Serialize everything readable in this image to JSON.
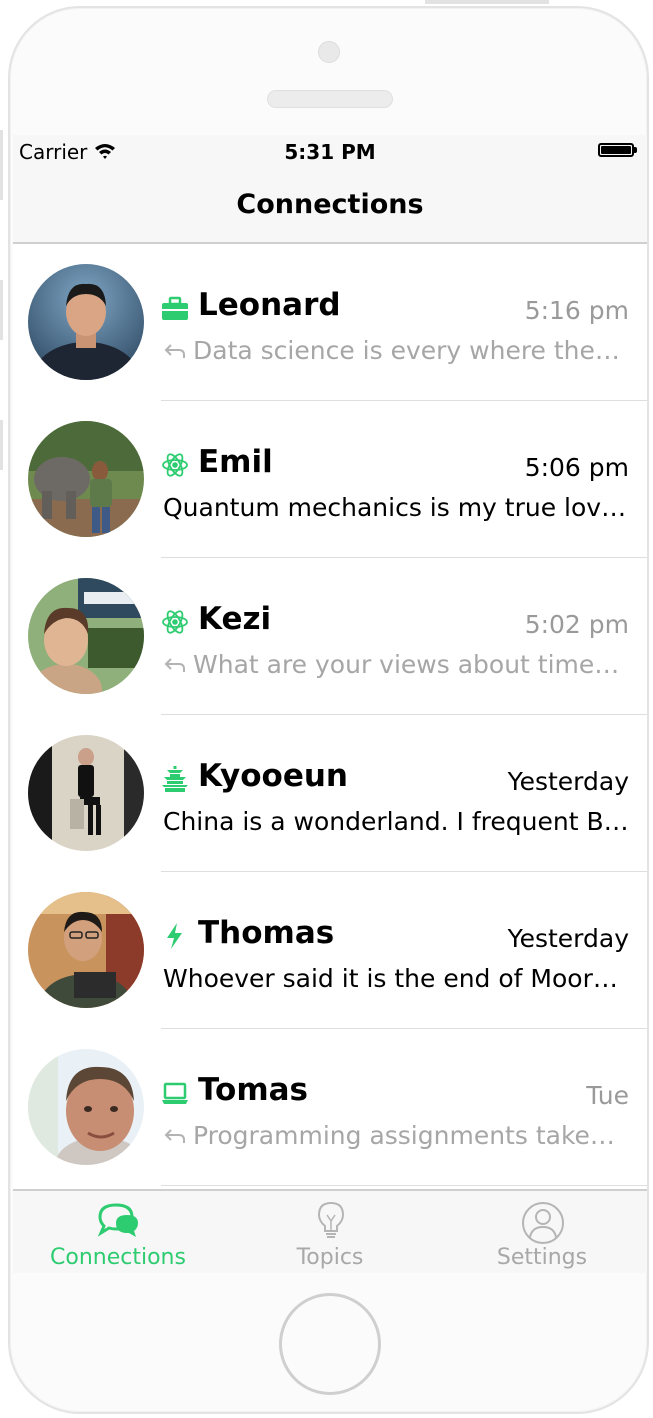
{
  "status_bar": {
    "carrier": "Carrier",
    "time": "5:31 PM"
  },
  "nav": {
    "title": "Connections"
  },
  "colors": {
    "accent": "#2ecc71",
    "muted_text": "#a6a6a6"
  },
  "conversations": [
    {
      "name": "Leonard",
      "topic_icon": "briefcase-icon",
      "time": "5:16 pm",
      "preview": "Data science is every where thes…",
      "unread": false,
      "replied": true
    },
    {
      "name": "Emil",
      "topic_icon": "atom-icon",
      "time": "5:06 pm",
      "preview": "Quantum mechanics is my true lov…",
      "unread": true,
      "replied": false
    },
    {
      "name": "Kezi",
      "topic_icon": "atom-icon",
      "time": "5:02 pm",
      "preview": "What are your views about time…",
      "unread": false,
      "replied": true
    },
    {
      "name": "Kyooeun",
      "topic_icon": "pagoda-icon",
      "time": "Yesterday",
      "preview": "China is a wonderland. I frequent B…",
      "unread": true,
      "replied": false
    },
    {
      "name": "Thomas",
      "topic_icon": "lightning-icon",
      "time": "Yesterday",
      "preview": "Whoever said it is the end of Moor…",
      "unread": true,
      "replied": false
    },
    {
      "name": "Tomas",
      "topic_icon": "laptop-icon",
      "time": "Tue",
      "preview": "Programming assignments take…",
      "unread": false,
      "replied": true
    }
  ],
  "tabs": [
    {
      "label": "Connections",
      "icon": "chat-bubbles-icon",
      "active": true
    },
    {
      "label": "Topics",
      "icon": "lightbulb-icon",
      "active": false
    },
    {
      "label": "Settings",
      "icon": "user-circle-icon",
      "active": false
    }
  ]
}
